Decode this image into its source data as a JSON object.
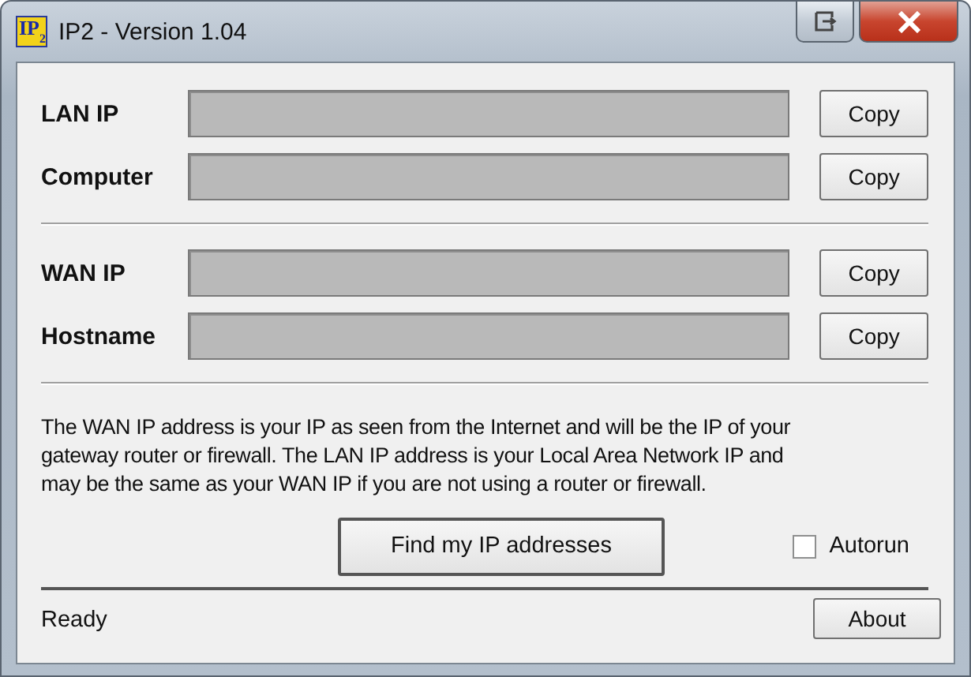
{
  "window": {
    "title": "IP2 - Version 1.04",
    "icon": {
      "text": "IP",
      "sub": "2"
    }
  },
  "groups": [
    [
      {
        "label": "LAN IP",
        "button": "Copy"
      },
      {
        "label": "Computer",
        "button": "Copy"
      }
    ],
    [
      {
        "label": "WAN IP",
        "button": "Copy"
      },
      {
        "label": "Hostname",
        "button": "Copy"
      }
    ]
  ],
  "info_lines": [
    "The WAN IP address is your IP as seen from the Internet and will be the IP of your",
    "gateway router or firewall. The LAN IP address is your Local Area Network IP and",
    "may be the same as your WAN IP if you are not using a router or firewall."
  ],
  "find_button": "Find my IP addresses",
  "autorun": {
    "label": "Autorun",
    "checked": false
  },
  "status": "Ready",
  "about_button": "About"
}
